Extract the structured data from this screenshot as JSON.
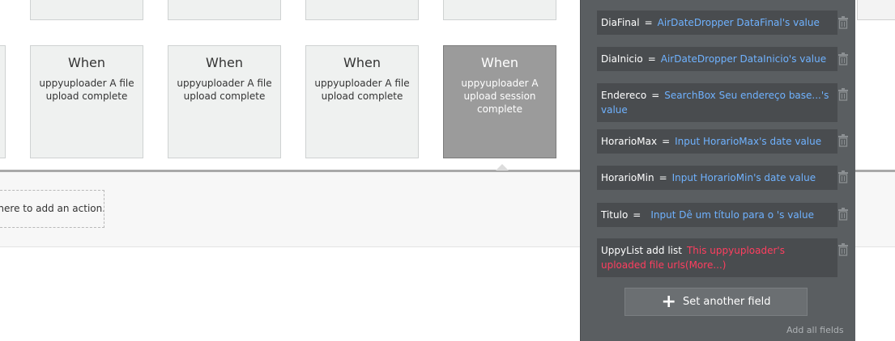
{
  "events": [
    {
      "title": "When",
      "desc": "uppyuploader A file upload complete"
    },
    {
      "title": "When",
      "desc": "uppyuploader A file upload complete"
    },
    {
      "title": "When",
      "desc": "uppyuploader A file upload complete"
    },
    {
      "title": "When",
      "desc": "uppyuploader A upload session complete"
    }
  ],
  "action_area": {
    "add_action": "Click here to add an action..."
  },
  "panel": {
    "fields": [
      {
        "key": "DiaFinal",
        "op": "=",
        "value": "AirDateDropper DataFinal's value"
      },
      {
        "key": "DiaInicio",
        "op": "=",
        "value": "AirDateDropper DataInicio's value"
      },
      {
        "key": "Endereco",
        "op": "=",
        "value": "SearchBox Seu endereço base...'s value"
      },
      {
        "key": "HorarioMax",
        "op": "=",
        "value": "Input HorarioMax's date value"
      },
      {
        "key": "HorarioMin",
        "op": "=",
        "value": "Input HorarioMin's date value"
      },
      {
        "key": "Titulo",
        "op": "=",
        "value": "Input Dê um título para o 's value"
      },
      {
        "key": "UppyList add list",
        "op": "",
        "value": "This uppyuploader's uploaded file urls(More...)"
      }
    ],
    "set_another_field": "Set another field",
    "add_all_fields": "Add all fields"
  },
  "icons": {
    "trash": "trash-icon",
    "plus": "plus-icon"
  },
  "colors": {
    "panel_bg": "#5a5e61",
    "field_bg": "#494c4f",
    "value_blue": "#6fb2ff",
    "value_red": "#ff3e5f",
    "selected_card": "#9b9b9b"
  }
}
